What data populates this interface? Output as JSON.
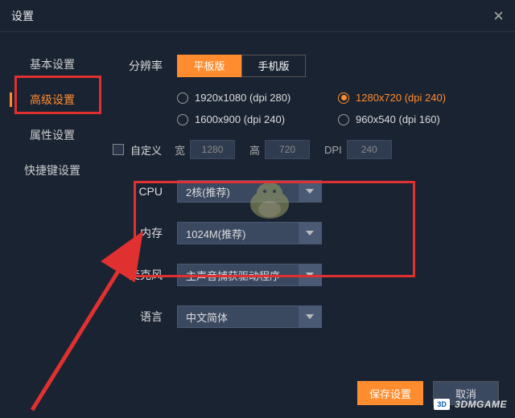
{
  "title": "设置",
  "sidebar": {
    "items": [
      {
        "label": "基本设置"
      },
      {
        "label": "高级设置"
      },
      {
        "label": "属性设置"
      },
      {
        "label": "快捷键设置"
      }
    ]
  },
  "resolution": {
    "label": "分辨率",
    "tabs": {
      "tablet": "平板版",
      "phone": "手机版"
    },
    "options": [
      "1920x1080 (dpi 280)",
      "1280x720 (dpi 240)",
      "1600x900 (dpi 240)",
      "960x540 (dpi 160)"
    ]
  },
  "custom": {
    "checkbox_label": "自定义",
    "width_label": "宽",
    "width_value": "1280",
    "height_label": "高",
    "height_value": "720",
    "dpi_label": "DPI",
    "dpi_value": "240"
  },
  "selects": {
    "cpu_label": "CPU",
    "cpu_value": "2核(推荐)",
    "mem_label": "内存",
    "mem_value": "1024M(推荐)",
    "mic_label": "麦克风",
    "mic_value": "主声音捕获驱动程序",
    "lang_label": "语言",
    "lang_value": "中文简体"
  },
  "buttons": {
    "save": "保存设置",
    "cancel": "取消"
  },
  "watermark": {
    "logo": "3D",
    "text": "3DMGAME"
  }
}
